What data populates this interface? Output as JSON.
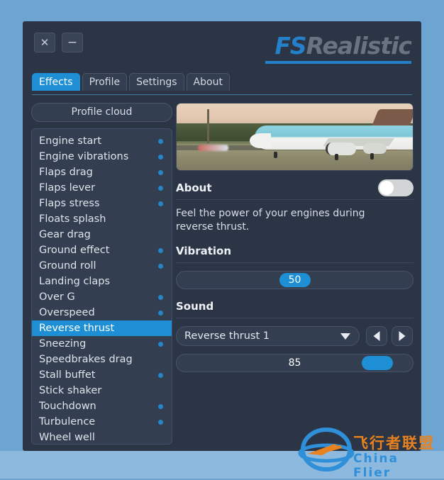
{
  "window": {
    "close_label": "✕",
    "minimize_label": "−",
    "logo_primary": "FS",
    "logo_secondary": "Realistic"
  },
  "tabs": [
    {
      "label": "Effects",
      "active": true
    },
    {
      "label": "Profile",
      "active": false
    },
    {
      "label": "Settings",
      "active": false
    },
    {
      "label": "About",
      "active": false
    }
  ],
  "sidebar": {
    "profile_cloud_label": "Profile cloud",
    "items": [
      {
        "label": "Engine start",
        "enabled": true,
        "selected": false
      },
      {
        "label": "Engine vibrations",
        "enabled": true,
        "selected": false
      },
      {
        "label": "Flaps drag",
        "enabled": true,
        "selected": false
      },
      {
        "label": "Flaps lever",
        "enabled": true,
        "selected": false
      },
      {
        "label": "Flaps stress",
        "enabled": true,
        "selected": false
      },
      {
        "label": "Floats splash",
        "enabled": false,
        "selected": false
      },
      {
        "label": "Gear drag",
        "enabled": false,
        "selected": false
      },
      {
        "label": "Ground effect",
        "enabled": true,
        "selected": false
      },
      {
        "label": "Ground roll",
        "enabled": true,
        "selected": false
      },
      {
        "label": "Landing claps",
        "enabled": false,
        "selected": false
      },
      {
        "label": "Over G",
        "enabled": true,
        "selected": false
      },
      {
        "label": "Overspeed",
        "enabled": true,
        "selected": false
      },
      {
        "label": "Reverse thrust",
        "enabled": false,
        "selected": true
      },
      {
        "label": "Sneezing",
        "enabled": true,
        "selected": false
      },
      {
        "label": "Speedbrakes drag",
        "enabled": false,
        "selected": false
      },
      {
        "label": "Stall buffet",
        "enabled": true,
        "selected": false
      },
      {
        "label": "Stick shaker",
        "enabled": false,
        "selected": false
      },
      {
        "label": "Touchdown",
        "enabled": true,
        "selected": false
      },
      {
        "label": "Turbulence",
        "enabled": true,
        "selected": false
      },
      {
        "label": "Wheel well",
        "enabled": false,
        "selected": false
      }
    ]
  },
  "detail": {
    "about": {
      "title": "About",
      "toggle_on": false,
      "description": "Feel the power of your engines during reverse thrust."
    },
    "vibration": {
      "title": "Vibration",
      "value": "50",
      "percent": 50
    },
    "sound": {
      "title": "Sound",
      "selected_sound": "Reverse thrust 1",
      "prev_label": "◀",
      "next_label": "▶",
      "volume_value": "85",
      "volume_percent": 85
    }
  },
  "watermark": {
    "cn_text": "飞行者联盟",
    "en_text": "China Flier"
  },
  "colors": {
    "accent": "#1e8fd5",
    "window_bg": "#2b3546",
    "panel_bg": "#333e50",
    "desktop_bg": "#6ea4d2",
    "logo_gray": "#6b7280",
    "watermark_orange": "#e8821e"
  }
}
